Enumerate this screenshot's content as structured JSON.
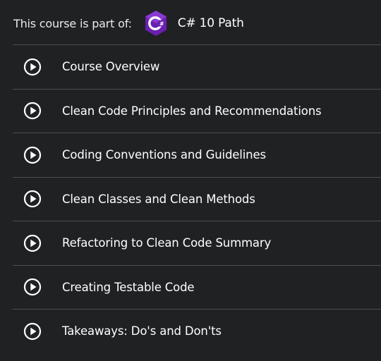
{
  "course_path": {
    "prefix": "This course is part of:",
    "badge_icon": "csharp-hexagon-icon",
    "badge_letters": "C#",
    "badge_color": "#7b2fbf",
    "name": "C# 10 Path"
  },
  "modules": [
    {
      "title": "Course Overview",
      "icon": "play-circle-icon"
    },
    {
      "title": "Clean Code Principles and Recommendations",
      "icon": "play-circle-icon"
    },
    {
      "title": "Coding Conventions and Guidelines",
      "icon": "play-circle-icon"
    },
    {
      "title": "Clean Classes and Clean Methods",
      "icon": "play-circle-icon"
    },
    {
      "title": "Refactoring to Clean Code Summary",
      "icon": "play-circle-icon"
    },
    {
      "title": "Creating Testable Code",
      "icon": "play-circle-icon"
    },
    {
      "title": "Takeaways: Do's and Don'ts",
      "icon": "play-circle-icon"
    }
  ],
  "colors": {
    "background": "#1f2123",
    "divider": "#4b4e52",
    "text": "#ffffff"
  }
}
